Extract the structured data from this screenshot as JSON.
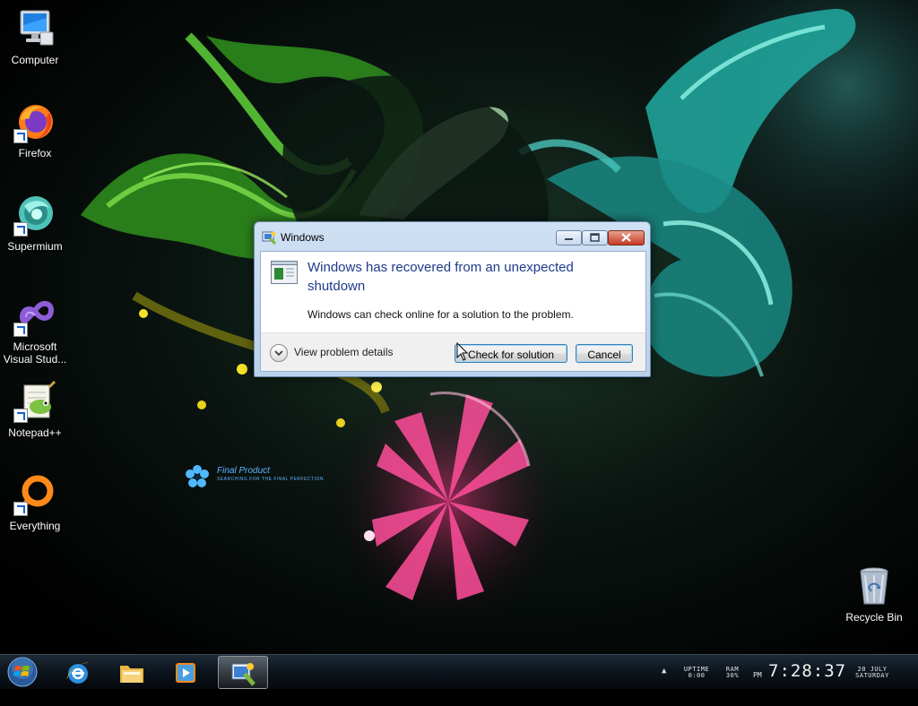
{
  "desktop": {
    "icons": [
      {
        "label": "Computer",
        "icon": "computer-icon"
      },
      {
        "label": "Firefox",
        "icon": "firefox-icon"
      },
      {
        "label": "Supermium",
        "icon": "supermium-icon"
      },
      {
        "label": "Microsoft Visual Stud...",
        "icon": "visual-studio-icon"
      },
      {
        "label": "Notepad++",
        "icon": "notepadpp-icon"
      },
      {
        "label": "Everything",
        "icon": "everything-icon"
      },
      {
        "label": "Recycle Bin",
        "icon": "recycle-bin-icon"
      }
    ],
    "wallpaper_brand": {
      "title": "Final Product",
      "subtitle": "Searching for the final perfection."
    }
  },
  "dialog": {
    "title": "Windows",
    "heading": "Windows has recovered from an unexpected shutdown",
    "body": "Windows can check online for a solution to the problem.",
    "details_label": "View problem details",
    "primary_button": "Check for solution",
    "cancel_button": "Cancel"
  },
  "taskbar": {
    "pinned": [
      {
        "name": "Internet Explorer",
        "icon": "internet-explorer-icon"
      },
      {
        "name": "File Explorer",
        "icon": "folder-icon"
      },
      {
        "name": "Media Player",
        "icon": "media-player-icon"
      },
      {
        "name": "Problem Reports",
        "icon": "problem-reports-icon",
        "active": true
      }
    ],
    "tray": {
      "uptime_label": "UPTIME",
      "uptime_value": "0:00",
      "ram_label": "RAM",
      "ram_value": "30%",
      "ampm": "PM",
      "time": "7:28:37",
      "date": "20 JULY",
      "weekday": "SATURDAY"
    }
  },
  "colors": {
    "heading": "#1e3a8a",
    "taskbar": "#0c141c",
    "close_button": "#c53a22"
  }
}
